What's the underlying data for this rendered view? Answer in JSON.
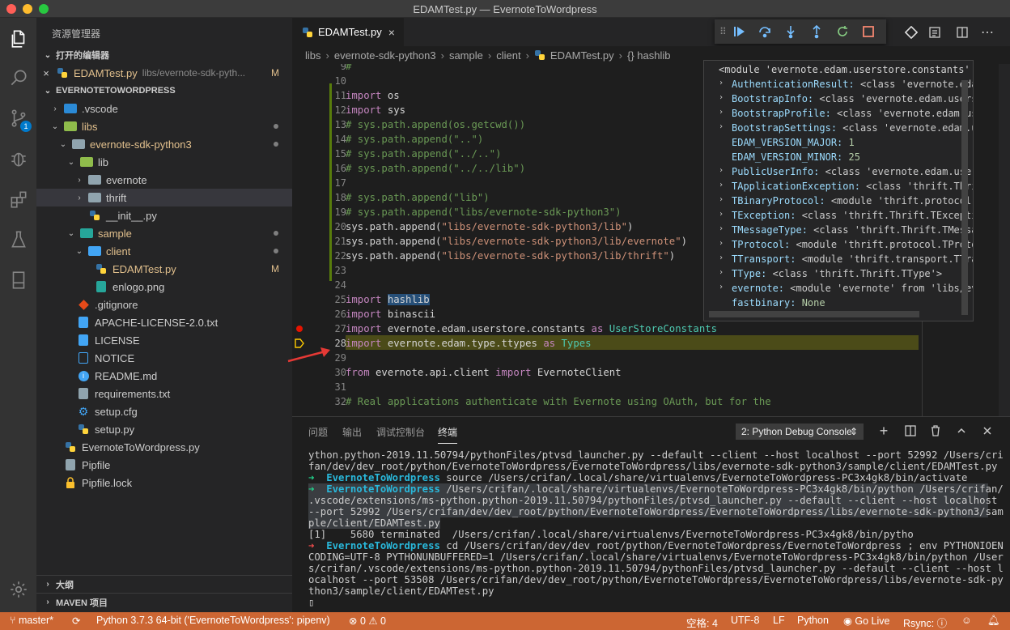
{
  "window": {
    "title": "EDAMTest.py — EvernoteToWordpress",
    "traffic_lights": {
      "close": "#ff5f57",
      "minimize": "#febc2e",
      "zoom": "#28c840"
    }
  },
  "activity_bar": {
    "items": [
      {
        "name": "explorer-icon"
      },
      {
        "name": "search-icon"
      },
      {
        "name": "source-control-icon",
        "badge": "1"
      },
      {
        "name": "debug-icon"
      },
      {
        "name": "extensions-icon"
      },
      {
        "name": "testing-icon"
      },
      {
        "name": "remote-icon"
      }
    ],
    "settings_icon": "gear-icon"
  },
  "sidebar": {
    "title": "资源管理器",
    "open_editors_label": "打开的编辑器",
    "open_editor": {
      "name": "EDAMTest.py",
      "path": "libs/evernote-sdk-pyth...",
      "status": "M"
    },
    "project_label": "EVERNOTETOWORDPRESS",
    "tree": [
      {
        "label": ".vscode",
        "kind": "folder"
      },
      {
        "label": "libs",
        "kind": "folder"
      },
      {
        "label": "evernote-sdk-python3",
        "kind": "folder"
      },
      {
        "label": "lib",
        "kind": "folder"
      },
      {
        "label": "evernote",
        "kind": "folder"
      },
      {
        "label": "thrift",
        "kind": "folder"
      },
      {
        "label": "__init__.py",
        "kind": "python"
      },
      {
        "label": "sample",
        "kind": "folder"
      },
      {
        "label": "client",
        "kind": "folder"
      },
      {
        "label": "EDAMTest.py",
        "kind": "python",
        "status": "M"
      },
      {
        "label": "enlogo.png",
        "kind": "image"
      },
      {
        "label": ".gitignore",
        "kind": "git"
      },
      {
        "label": "APACHE-LICENSE-2.0.txt",
        "kind": "text"
      },
      {
        "label": "LICENSE",
        "kind": "text"
      },
      {
        "label": "NOTICE",
        "kind": "text"
      },
      {
        "label": "README.md",
        "kind": "info"
      },
      {
        "label": "requirements.txt",
        "kind": "text"
      },
      {
        "label": "setup.cfg",
        "kind": "gear"
      },
      {
        "label": "setup.py",
        "kind": "python"
      },
      {
        "label": "EvernoteToWordpress.py",
        "kind": "python"
      },
      {
        "label": "Pipfile",
        "kind": "text"
      },
      {
        "label": "Pipfile.lock",
        "kind": "lock"
      }
    ],
    "outline_label": "大纲",
    "maven_label": "MAVEN 项目"
  },
  "tab": {
    "label": "EDAMTest.py",
    "close": "×"
  },
  "breadcrumb": [
    "libs",
    "evernote-sdk-python3",
    "sample",
    "client",
    "EDAMTest.py",
    "{} hashlib"
  ],
  "editor": {
    "line_numbers": [
      "9",
      "10",
      "11",
      "12",
      "13",
      "14",
      "15",
      "16",
      "17",
      "18",
      "19",
      "20",
      "21",
      "22",
      "23",
      "24",
      "25",
      "26",
      "27",
      "28",
      "29",
      "30",
      "31",
      "32"
    ],
    "lines": {
      "l9": "#",
      "l11a": "import",
      "l11b": " os",
      "l12a": "import",
      "l12b": " sys",
      "l13": "# sys.path.append(os.getcwd())",
      "l14": "# sys.path.append(\"..\")",
      "l15": "# sys.path.append(\"../..\")",
      "l16": "# sys.path.append(\"../../lib\")",
      "l18": "# sys.path.append(\"lib\")",
      "l19": "# sys.path.append(\"libs/evernote-sdk-python3\")",
      "l20a": "sys.path.append(",
      "l20b": "\"libs/evernote-sdk-python3/lib\"",
      "l20c": ")",
      "l21a": "sys.path.append(",
      "l21b": "\"libs/evernote-sdk-python3/lib/evernote\"",
      "l21c": ")",
      "l22a": "sys.path.append(",
      "l22b": "\"libs/evernote-sdk-python3/lib/thrift\"",
      "l22c": ")",
      "l25a": "import",
      "l25b": "hashlib",
      "l26a": "import",
      "l26b": " binascii",
      "l27a": "import",
      "l27b": " evernote.edam.userstore.constants ",
      "l27c": "as",
      "l27d": " UserStoreConstants",
      "l28a": "import",
      "l28b": " evernote.edam.type.ttypes ",
      "l28c": "as",
      "l28d": " Types",
      "l30a": "from",
      "l30b": " evernote.api.client ",
      "l30c": "import",
      "l30d": " EvernoteClient",
      "l32": "# Real applications authenticate with Evernote using OAuth, but for the"
    }
  },
  "hover": {
    "header": "<module 'evernote.edam.userstore.constants' f…",
    "rows": [
      {
        "k": "AuthenticationResult:",
        "v": " <class 'evernote.edam.u",
        "exp": true
      },
      {
        "k": "BootstrapInfo:",
        "v": " <class 'evernote.edam.userstor",
        "exp": true
      },
      {
        "k": "BootstrapProfile:",
        "v": " <class 'evernote.edam.users",
        "exp": true
      },
      {
        "k": "BootstrapSettings:",
        "v": " <class 'evernote.edam.user",
        "exp": true
      },
      {
        "k": "EDAM_VERSION_MAJOR:",
        "v": " 1",
        "exp": false
      },
      {
        "k": "EDAM_VERSION_MINOR:",
        "v": " 25",
        "exp": false
      },
      {
        "k": "PublicUserInfo:",
        "v": " <class 'evernote.edam.userst",
        "exp": true
      },
      {
        "k": "TApplicationException:",
        "v": " <class 'thrift.Thrift.",
        "exp": true
      },
      {
        "k": "TBinaryProtocol:",
        "v": " <module 'thrift.protocol.TBi",
        "exp": true
      },
      {
        "k": "TException:",
        "v": " <class 'thrift.Thrift.TException'",
        "exp": true
      },
      {
        "k": "TMessageType:",
        "v": " <class 'thrift.Thrift.TMessage",
        "exp": true
      },
      {
        "k": "TProtocol:",
        "v": " <module 'thrift.protocol.TProtocol",
        "exp": true
      },
      {
        "k": "TTransport:",
        "v": " <module 'thrift.transport.TTransp",
        "exp": true
      },
      {
        "k": "TType:",
        "v": " <class 'thrift.Thrift.TType'>",
        "exp": true
      },
      {
        "k": "evernote:",
        "v": " <module 'evernote' from 'libs/evern",
        "exp": true
      },
      {
        "k": "fastbinary:",
        "v": " None",
        "exp": false
      }
    ]
  },
  "panel": {
    "tabs": [
      "问题",
      "输出",
      "调试控制台",
      "终端"
    ],
    "terminal_select": "2: Python Debug Console",
    "terminal": {
      "t1": "ython.python-2019.11.50794/pythonFiles/ptvsd_launcher.py --default --client --host localhost --port 52992 /Users/cri",
      "t2": "fan/dev/dev_root/python/EvernoteToWordpress/EvernoteToWordpress/libs/evernote-sdk-python3/sample/client/EDAMTest.py",
      "t3arrow": "➜",
      "t3dir": "  EvernoteToWordpress",
      "t3cmd": " source /Users/crifan/.local/share/virtualenvs/EvernoteToWordpress-PC3x4gk8/bin/activate",
      "t4arrow": "➜",
      "t4dir": "  EvernoteToWordpress",
      "t4cmd": " /Users/crifan/.local/share/virtualenvs/EvernoteToWordpress-PC3x4gk8/bin/python /Users/crifan/",
      "t5": ".vscode/extensions/ms-python.python-2019.11.50794/pythonFiles/ptvsd_launcher.py --default --client --host localhost ",
      "t6": "--port 52992 /Users/crifan/dev/dev_root/python/EvernoteToWordpress/EvernoteToWordpress/libs/evernote-sdk-python3/sam",
      "t7": "ple/client/EDAMTest.py",
      "t8": "[1]    5680 terminated  /Users/crifan/.local/share/virtualenvs/EvernoteToWordpress-PC3x4gk8/bin/pytho",
      "t9arrow": "➜",
      "t9dir": "  EvernoteToWordpress",
      "t9cmd": " cd /Users/crifan/dev/dev_root/python/EvernoteToWordpress/EvernoteToWordpress ; env PYTHONIOEN",
      "t10": "CODING=UTF-8 PYTHONUNBUFFERED=1 /Users/crifan/.local/share/virtualenvs/EvernoteToWordpress-PC3x4gk8/bin/python /User",
      "t11": "s/crifan/.vscode/extensions/ms-python.python-2019.11.50794/pythonFiles/ptvsd_launcher.py --default --client --host l",
      "t12": "ocalhost --port 53508 /Users/crifan/dev/dev_root/python/EvernoteToWordpress/EvernoteToWordpress/libs/evernote-sdk-py",
      "t13": "thon3/sample/client/EDAMTest.py",
      "t14": "▯"
    }
  },
  "status": {
    "branch": "master*",
    "interpreter": "Python 3.7.3 64-bit ('EvernoteToWordpress': pipenv)",
    "problems": "⊗ 0 ⚠ 0",
    "spaces": "空格: 4",
    "encoding": "UTF-8",
    "eol": "LF",
    "language": "Python",
    "go_live": "Go Live",
    "rsync": "Rsync: ⓘ",
    "background": "#cc6633"
  },
  "colors": {
    "accent": "#007acc",
    "gutter_added": "#587c0c",
    "breakpoint": "#e51400"
  }
}
